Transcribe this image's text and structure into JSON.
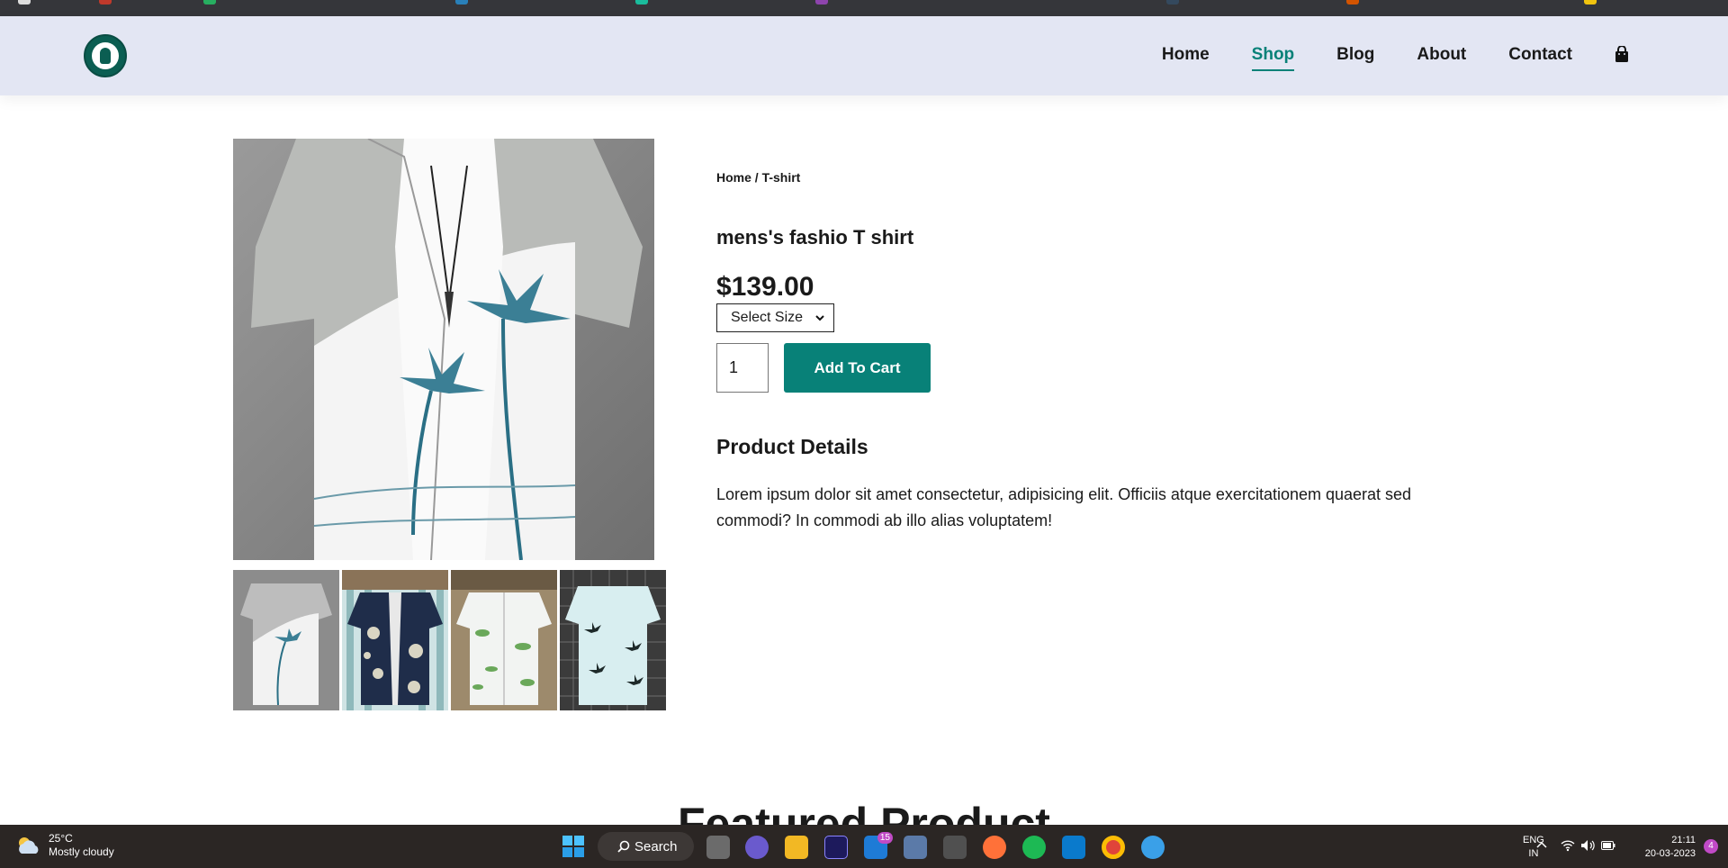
{
  "header": {
    "nav": [
      {
        "label": "Home",
        "active": false
      },
      {
        "label": "Shop",
        "active": true
      },
      {
        "label": "Blog",
        "active": false
      },
      {
        "label": "About",
        "active": false
      },
      {
        "label": "Contact",
        "active": false
      }
    ],
    "cart_icon": "shopping-bag-icon",
    "accent_color": "#088178"
  },
  "product": {
    "breadcrumb": "Home / T-shirt",
    "title": "mens's fashio T shirt",
    "price": "$139.00",
    "size_select": "Select Size",
    "quantity": "1",
    "add_to_cart": "Add To Cart",
    "details_heading": "Product Details",
    "details_text": "Lorem ipsum dolor sit amet consectetur, adipisicing elit. Officiis atque exercitationem quaerat sed commodi? In commodi ab illo alias voluptatem!"
  },
  "featured_heading": "Featured Product",
  "taskbar": {
    "weather_temp": "25°C",
    "weather_desc": "Mostly cloudy",
    "search_label": "Search",
    "mail_badge": "15",
    "lang_top": "ENG",
    "lang_bottom": "IN",
    "time": "21:11",
    "date": "20-03-2023",
    "notifications": "4"
  }
}
